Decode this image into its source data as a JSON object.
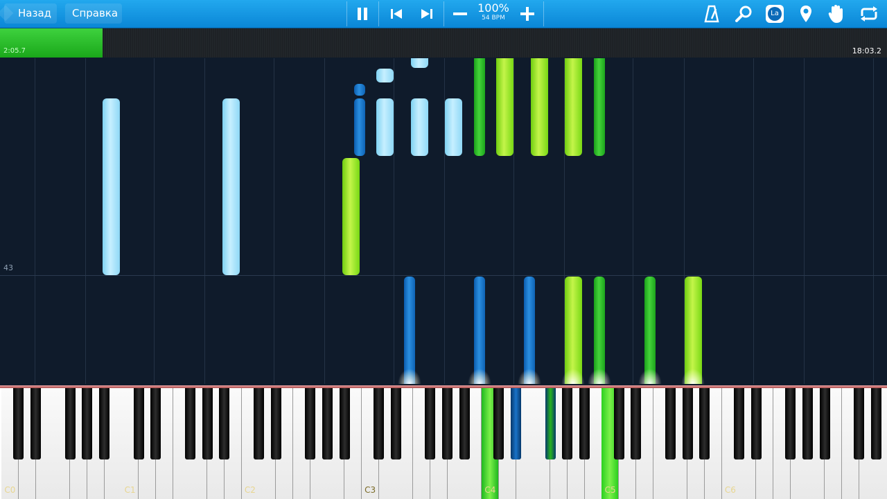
{
  "toolbar": {
    "back_label": "Назад",
    "help_label": "Справка",
    "speed_percent": "100%",
    "speed_bpm": "54 BPM",
    "icons": [
      "pause-icon",
      "previous-icon",
      "next-icon",
      "minus-icon",
      "plus-icon",
      "metronome-icon",
      "magnifier-icon",
      "label-icon",
      "location-pin-icon",
      "hand-icon",
      "loop-icon"
    ],
    "label_icon_text": "La"
  },
  "timeline": {
    "elapsed": "2:05.7",
    "total": "18:03.2",
    "progress": 0.116
  },
  "notes_area": {
    "measure_number": "43"
  },
  "keyboard": {
    "octave_labels": [
      "C0",
      "C1",
      "C2",
      "C3",
      "C4",
      "C5",
      "C6"
    ],
    "active_octave": "C3"
  },
  "colors": {
    "toolbar": "#0f92df",
    "background": "#0f1b2b",
    "light_blue_note": "#a8e4fb",
    "dark_blue_note": "#1a77cf",
    "lime_note": "#a8ea2c",
    "green_note": "#2ebc26"
  }
}
